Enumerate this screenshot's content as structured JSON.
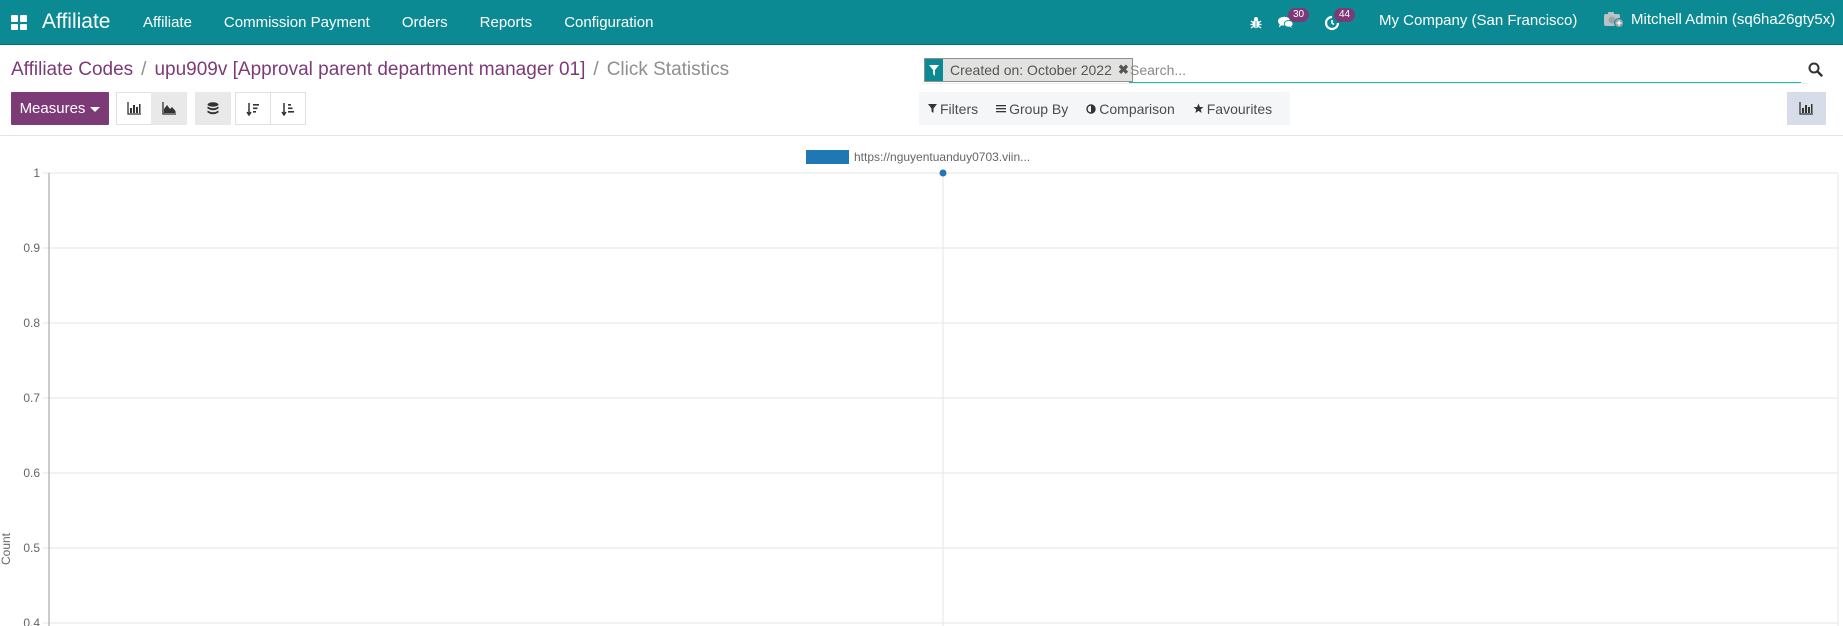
{
  "navbar": {
    "apps_icon": "apps-grid-icon",
    "brand": "Affiliate",
    "menu": [
      "Affiliate",
      "Commission Payment",
      "Orders",
      "Reports",
      "Configuration"
    ],
    "debug_icon": "bug-icon",
    "messages_badge": "30",
    "activities_badge": "44",
    "company": "My Company (San Francisco)",
    "user": "Mitchell Admin (sq6ha26gty5x)"
  },
  "breadcrumb": {
    "items": [
      "Affiliate Codes",
      "upu909v [Approval parent department manager 01]"
    ],
    "separator": "/",
    "current": "Click Statistics"
  },
  "toolbar": {
    "measures_label": "Measures",
    "chart_types": [
      {
        "name": "bar-chart",
        "active": false
      },
      {
        "name": "line-chart",
        "active": true
      }
    ],
    "stacked_active": true,
    "sort": [
      "sort-descending",
      "sort-ascending"
    ]
  },
  "search": {
    "facet_label": "Created on: October 2022",
    "placeholder": "Search...",
    "value": ""
  },
  "filters": {
    "filters_label": "Filters",
    "groupby_label": "Group By",
    "comparison_label": "Comparison",
    "favourites_label": "Favourites"
  },
  "colors": {
    "navbar": "#0b8a94",
    "primary": "#7c3b77",
    "series": "#1f77b4"
  },
  "chart_data": {
    "type": "line",
    "title": "",
    "xlabel": "",
    "ylabel": "Count",
    "ylim": [
      0.4,
      1
    ],
    "yticks": [
      "1",
      "0.9",
      "0.8",
      "0.7",
      "0.6",
      "0.5",
      "0.4"
    ],
    "ytick_values": [
      1,
      0.9,
      0.8,
      0.7,
      0.6,
      0.5,
      0.4
    ],
    "grid": true,
    "legend": "top-center",
    "x": [
      ""
    ],
    "series": [
      {
        "name": "https://nguyentuanduy0703.viin...",
        "values": [
          1
        ],
        "color": "#1f77b4"
      }
    ]
  }
}
